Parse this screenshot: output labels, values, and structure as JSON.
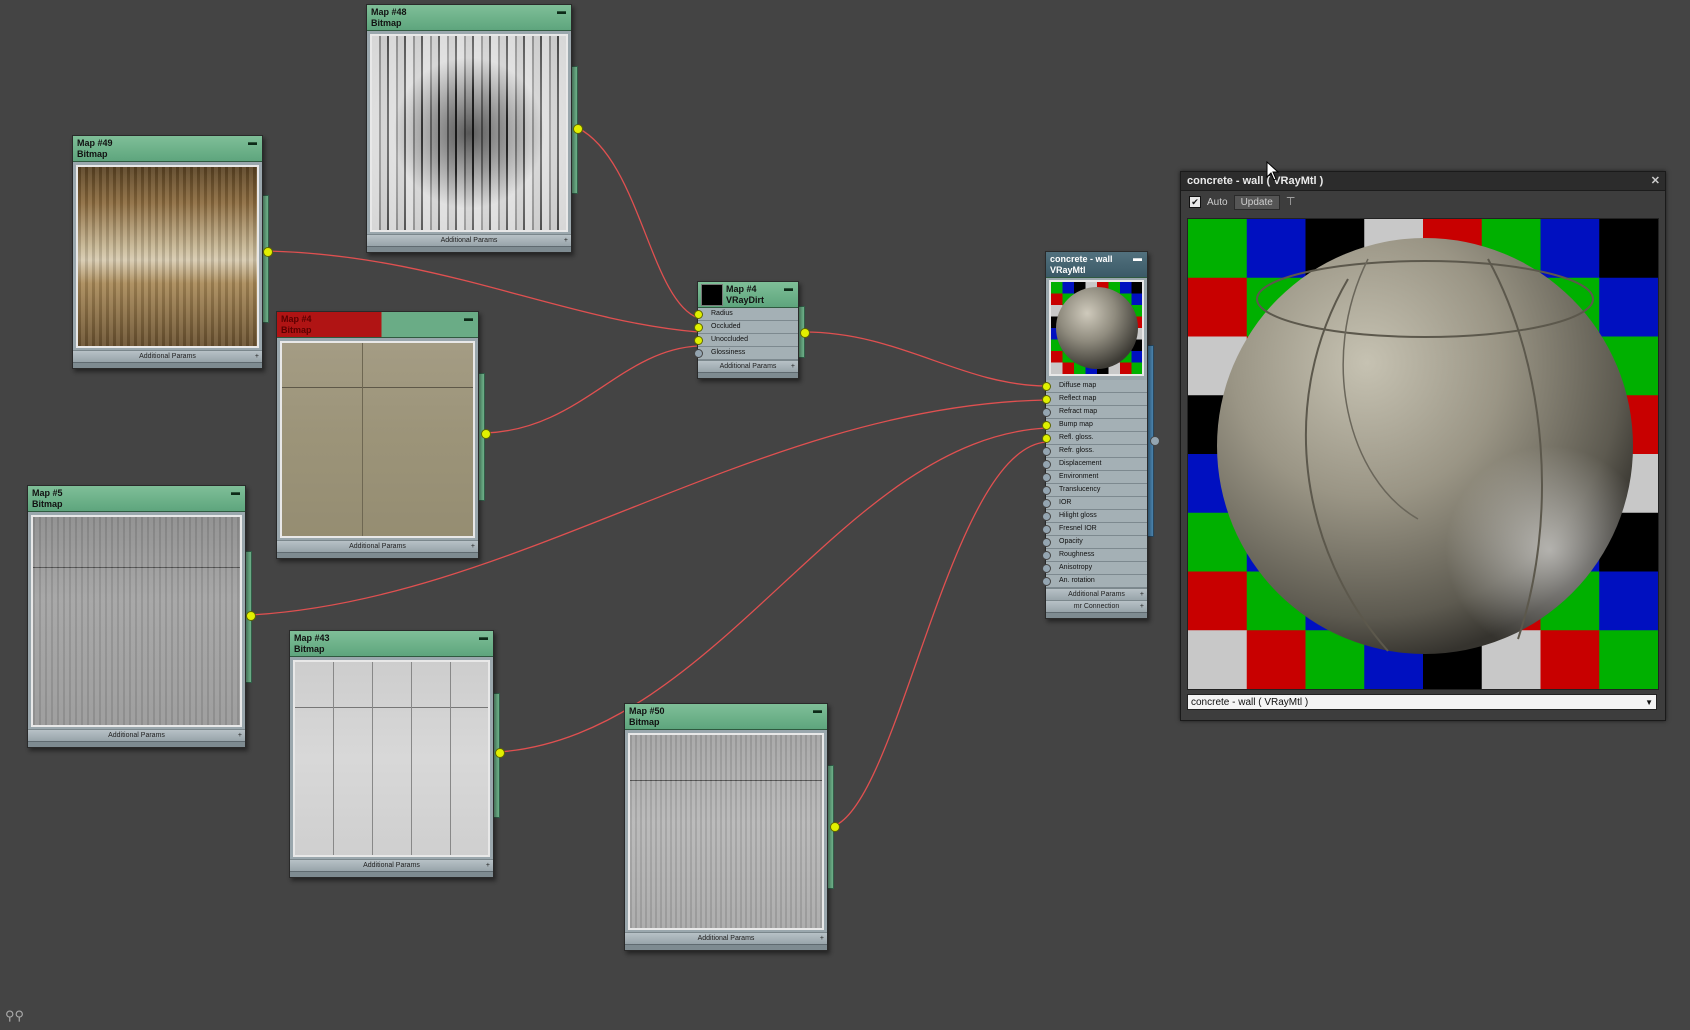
{
  "preview": {
    "title": "concrete - wall  ( VRayMtl )",
    "auto_label": "Auto",
    "auto_checked": "✔",
    "update_label": "Update",
    "select_value": "concrete - wall  ( VRayMtl )"
  },
  "nodes": {
    "map48": {
      "title": "Map #48",
      "type": "Bitmap",
      "footer": "Additional Params"
    },
    "map49": {
      "title": "Map #49",
      "type": "Bitmap",
      "footer": "Additional Params"
    },
    "map4bitmap": {
      "title": "Map #4",
      "type": "Bitmap",
      "footer": "Additional Params"
    },
    "map5": {
      "title": "Map #5",
      "type": "Bitmap",
      "footer": "Additional Params"
    },
    "map43": {
      "title": "Map #43",
      "type": "Bitmap",
      "footer": "Additional Params"
    },
    "map50": {
      "title": "Map #50",
      "type": "Bitmap",
      "footer": "Additional Params"
    },
    "vraydirt": {
      "title": "Map #4",
      "type": "VRayDirt",
      "footer": "Additional Params",
      "slots": [
        "Radius",
        "Occluded",
        "Unoccluded",
        "Glossiness"
      ]
    },
    "material": {
      "title": "concrete - wall",
      "type": "VRayMtl",
      "footer": "Additional Params",
      "footer2": "mr Connection",
      "slots": [
        "Diffuse map",
        "Reflect map",
        "Refract map",
        "Bump map",
        "Refl. gloss.",
        "Refr. gloss.",
        "Displacement",
        "Environment",
        "Translucency",
        "IOR",
        "Hilight gloss",
        "Fresnel IOR",
        "Opacity",
        "Roughness",
        "Anisotropy",
        "An. rotation"
      ]
    }
  },
  "colors": {
    "canvas": "#444444",
    "node_header": "#6aac86",
    "wire": "#e05050",
    "port": "#e2f000",
    "checker": [
      "#00b000",
      "#0010c0",
      "#000000",
      "#c8c8c8",
      "#c80000"
    ]
  }
}
